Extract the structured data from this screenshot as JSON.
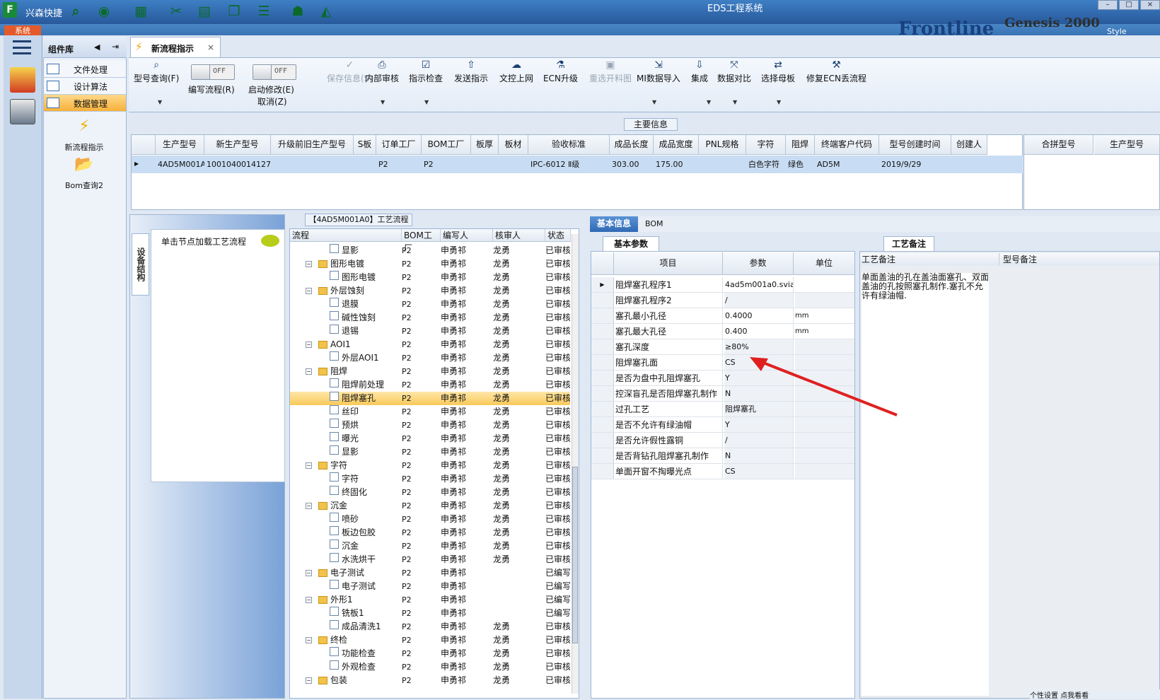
{
  "window": {
    "title": "EDS工程系统",
    "quick_label": "兴森快捷",
    "app_logo": "F",
    "style_label": "Style",
    "brand": "Frontline",
    "brand2": "Genesis 2000"
  },
  "system_tab": "系统",
  "component_library": {
    "title": "组件库",
    "items": [
      {
        "label": "文件处理",
        "active": false
      },
      {
        "label": "设计算法",
        "active": false
      },
      {
        "label": "数据管理",
        "active": true
      }
    ],
    "big_items": [
      {
        "label": "新流程指示",
        "icon": "lightning-icon"
      },
      {
        "label": "Bom查询2",
        "icon": "folder-open-icon"
      }
    ]
  },
  "doc_tab": {
    "title": "新流程指示",
    "close": "×"
  },
  "toolbar": {
    "buttons": [
      {
        "label": "型号查询(F)",
        "icon": "search-icon",
        "disabled": false
      },
      {
        "label": "编写流程(R)",
        "toggle": "OFF"
      },
      {
        "label": "启动修改(E)",
        "sublabel": "取消(Z)",
        "toggle": "OFF"
      },
      {
        "label": "保存信息(S)",
        "icon": "check-icon",
        "disabled": true
      },
      {
        "label": "内部审核",
        "icon": "printer-icon",
        "disabled": false
      },
      {
        "label": "指示检查",
        "icon": "checkbox-icon",
        "disabled": false
      },
      {
        "label": "发送指示",
        "icon": "upload-icon",
        "disabled": false
      },
      {
        "label": "文控上网",
        "icon": "cloud-upload-icon",
        "disabled": false
      },
      {
        "label": "ECN升级",
        "icon": "flask-icon",
        "disabled": false
      },
      {
        "label": "重选开料图",
        "icon": "image-icon",
        "disabled": true
      },
      {
        "label": "MI数据导入",
        "icon": "import-icon",
        "disabled": false
      },
      {
        "label": "集成",
        "icon": "download-icon",
        "disabled": false
      },
      {
        "label": "数据对比",
        "icon": "compare-icon",
        "disabled": false
      },
      {
        "label": "选择母板",
        "icon": "shuffle-icon",
        "disabled": false
      },
      {
        "label": "修复ECN丢流程",
        "icon": "wrench-icon",
        "disabled": false
      }
    ]
  },
  "main_info": {
    "label": "主要信息",
    "columns": [
      "生产型号",
      "新生产型号",
      "升级前旧生产型号",
      "S板",
      "订单工厂",
      "BOM工厂",
      "板厚",
      "板材",
      "验收标准",
      "成品长度",
      "成品宽度",
      "PNL规格",
      "字符",
      "阻焊",
      "终端客户代码",
      "型号创建时间",
      "创建人"
    ],
    "row": [
      "4AD5M001A0",
      "10010400141274",
      "",
      "",
      "P2",
      "P2",
      "",
      "",
      "IPC-6012 Ⅱ级",
      "303.00",
      "175.00",
      "",
      "白色字符",
      "绿色",
      "AD5M",
      "2019/9/29",
      ""
    ],
    "merge_columns": [
      "合拼型号",
      "生产型号"
    ]
  },
  "left_panel": {
    "vertical_tab": "设备结构",
    "hint": "单击节点加载工艺流程"
  },
  "flow": {
    "title": "【4AD5M001A0】工艺流程",
    "columns": [
      "流程",
      "BOM工厂",
      "编写人",
      "核审人",
      "状态"
    ],
    "rows": [
      {
        "level": 2,
        "type": "doc",
        "name": "显影",
        "bom": "P2",
        "writer": "申勇祁",
        "reviewer": "龙勇",
        "status": "已审核"
      },
      {
        "level": 1,
        "type": "folder",
        "name": "图形电镀",
        "bom": "P2",
        "writer": "申勇祁",
        "reviewer": "龙勇",
        "status": "已审核"
      },
      {
        "level": 2,
        "type": "doc",
        "name": "图形电镀",
        "bom": "P2",
        "writer": "申勇祁",
        "reviewer": "龙勇",
        "status": "已审核"
      },
      {
        "level": 1,
        "type": "folder",
        "name": "外层蚀刻",
        "bom": "P2",
        "writer": "申勇祁",
        "reviewer": "龙勇",
        "status": "已审核"
      },
      {
        "level": 2,
        "type": "doc",
        "name": "退膜",
        "bom": "P2",
        "writer": "申勇祁",
        "reviewer": "龙勇",
        "status": "已审核"
      },
      {
        "level": 2,
        "type": "doc",
        "name": "碱性蚀刻",
        "bom": "P2",
        "writer": "申勇祁",
        "reviewer": "龙勇",
        "status": "已审核"
      },
      {
        "level": 2,
        "type": "doc",
        "name": "退锡",
        "bom": "P2",
        "writer": "申勇祁",
        "reviewer": "龙勇",
        "status": "已审核"
      },
      {
        "level": 1,
        "type": "folder",
        "name": "AOI1",
        "bom": "P2",
        "writer": "申勇祁",
        "reviewer": "龙勇",
        "status": "已审核"
      },
      {
        "level": 2,
        "type": "doc",
        "name": "外层AOI1",
        "bom": "P2",
        "writer": "申勇祁",
        "reviewer": "龙勇",
        "status": "已审核"
      },
      {
        "level": 1,
        "type": "folder",
        "name": "阻焊",
        "bom": "P2",
        "writer": "申勇祁",
        "reviewer": "龙勇",
        "status": "已审核"
      },
      {
        "level": 2,
        "type": "doc",
        "name": "阻焊前处理",
        "bom": "P2",
        "writer": "申勇祁",
        "reviewer": "龙勇",
        "status": "已审核"
      },
      {
        "level": 2,
        "type": "doc",
        "name": "阻焊塞孔",
        "bom": "P2",
        "writer": "申勇祁",
        "reviewer": "龙勇",
        "status": "已审核",
        "selected": true
      },
      {
        "level": 2,
        "type": "doc",
        "name": "丝印",
        "bom": "P2",
        "writer": "申勇祁",
        "reviewer": "龙勇",
        "status": "已审核"
      },
      {
        "level": 2,
        "type": "doc",
        "name": "预烘",
        "bom": "P2",
        "writer": "申勇祁",
        "reviewer": "龙勇",
        "status": "已审核"
      },
      {
        "level": 2,
        "type": "doc",
        "name": "曝光",
        "bom": "P2",
        "writer": "申勇祁",
        "reviewer": "龙勇",
        "status": "已审核"
      },
      {
        "level": 2,
        "type": "doc",
        "name": "显影",
        "bom": "P2",
        "writer": "申勇祁",
        "reviewer": "龙勇",
        "status": "已审核"
      },
      {
        "level": 1,
        "type": "folder",
        "name": "字符",
        "bom": "P2",
        "writer": "申勇祁",
        "reviewer": "龙勇",
        "status": "已审核"
      },
      {
        "level": 2,
        "type": "doc",
        "name": "字符",
        "bom": "P2",
        "writer": "申勇祁",
        "reviewer": "龙勇",
        "status": "已审核"
      },
      {
        "level": 2,
        "type": "doc",
        "name": "终固化",
        "bom": "P2",
        "writer": "申勇祁",
        "reviewer": "龙勇",
        "status": "已审核"
      },
      {
        "level": 1,
        "type": "folder",
        "name": "沉金",
        "bom": "P2",
        "writer": "申勇祁",
        "reviewer": "龙勇",
        "status": "已审核"
      },
      {
        "level": 2,
        "type": "doc",
        "name": "喷砂",
        "bom": "P2",
        "writer": "申勇祁",
        "reviewer": "龙勇",
        "status": "已审核"
      },
      {
        "level": 2,
        "type": "doc",
        "name": "板边包胶",
        "bom": "P2",
        "writer": "申勇祁",
        "reviewer": "龙勇",
        "status": "已审核"
      },
      {
        "level": 2,
        "type": "doc",
        "name": "沉金",
        "bom": "P2",
        "writer": "申勇祁",
        "reviewer": "龙勇",
        "status": "已审核"
      },
      {
        "level": 2,
        "type": "doc",
        "name": "水洗烘干",
        "bom": "P2",
        "writer": "申勇祁",
        "reviewer": "龙勇",
        "status": "已审核"
      },
      {
        "level": 1,
        "type": "folder",
        "name": "电子测试",
        "bom": "P2",
        "writer": "申勇祁",
        "reviewer": "",
        "status": "已编写"
      },
      {
        "level": 2,
        "type": "doc",
        "name": "电子测试",
        "bom": "P2",
        "writer": "申勇祁",
        "reviewer": "",
        "status": "已编写"
      },
      {
        "level": 1,
        "type": "folder",
        "name": "外形1",
        "bom": "P2",
        "writer": "申勇祁",
        "reviewer": "",
        "status": "已编写"
      },
      {
        "level": 2,
        "type": "doc",
        "name": "铣板1",
        "bom": "P2",
        "writer": "申勇祁",
        "reviewer": "",
        "status": "已编写"
      },
      {
        "level": 2,
        "type": "doc",
        "name": "成品清洗1",
        "bom": "P2",
        "writer": "申勇祁",
        "reviewer": "龙勇",
        "status": "已审核"
      },
      {
        "level": 1,
        "type": "folder",
        "name": "终检",
        "bom": "P2",
        "writer": "申勇祁",
        "reviewer": "龙勇",
        "status": "已审核"
      },
      {
        "level": 2,
        "type": "doc",
        "name": "功能检查",
        "bom": "P2",
        "writer": "申勇祁",
        "reviewer": "龙勇",
        "status": "已审核"
      },
      {
        "level": 2,
        "type": "doc",
        "name": "外观检查",
        "bom": "P2",
        "writer": "申勇祁",
        "reviewer": "龙勇",
        "status": "已审核"
      },
      {
        "level": 1,
        "type": "folder",
        "name": "包装",
        "bom": "P2",
        "writer": "申勇祁",
        "reviewer": "龙勇",
        "status": "已审核"
      }
    ]
  },
  "detail_tabs": {
    "basic": "基本信息",
    "bom": "BOM"
  },
  "params": {
    "tab": "基本参数",
    "columns": [
      "项目",
      "参数",
      "单位"
    ],
    "rows": [
      {
        "item": "阻焊塞孔程序1",
        "value": "4ad5m001a0.svia",
        "unit": ""
      },
      {
        "item": "阻焊塞孔程序2",
        "value": "/",
        "unit": ""
      },
      {
        "item": "塞孔最小孔径",
        "value": "0.4000",
        "unit": "mm"
      },
      {
        "item": "塞孔最大孔径",
        "value": "0.400",
        "unit": "mm"
      },
      {
        "item": "塞孔深度",
        "value": "≥80%",
        "unit": ""
      },
      {
        "item": "阻焊塞孔面",
        "value": "CS",
        "unit": ""
      },
      {
        "item": "是否为盘中孔阻焊塞孔",
        "value": "Y",
        "unit": ""
      },
      {
        "item": "控深盲孔是否阻焊塞孔制作",
        "value": "N",
        "unit": ""
      },
      {
        "item": "过孔工艺",
        "value": "阻焊塞孔",
        "unit": ""
      },
      {
        "item": "是否不允许有绿油帽",
        "value": "Y",
        "unit": ""
      },
      {
        "item": "是否允许假性露铜",
        "value": "/",
        "unit": ""
      },
      {
        "item": "是否背钻孔阻焊塞孔制作",
        "value": "N",
        "unit": ""
      },
      {
        "item": "单面开窗不掏曝光点",
        "value": "CS",
        "unit": ""
      }
    ]
  },
  "remarks": {
    "tab": "工艺备注",
    "col_remark": "工艺备注",
    "col_model": "型号备注",
    "text": "单面盖油的孔在盖油面塞孔、双面盖油的孔按照塞孔制作.塞孔不允许有绿油帽."
  },
  "bottom_buttons": "个性设置   点我看看",
  "colors": {
    "accent": "#2f69b3",
    "selected_row": "#f9c95a",
    "arrow": "#e02020"
  }
}
